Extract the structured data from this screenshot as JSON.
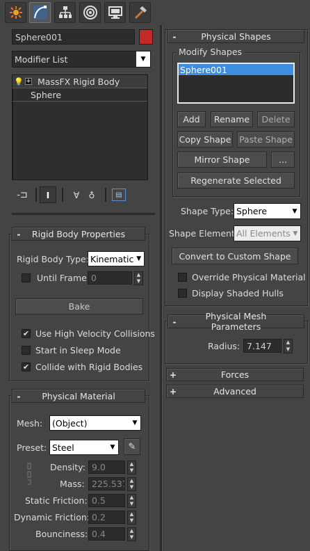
{
  "tabs": [
    {
      "name": "create-tab",
      "icon": "sun-icon"
    },
    {
      "name": "modify-tab",
      "icon": "curve-icon",
      "active": true
    },
    {
      "name": "hierarchy-tab",
      "icon": "hierarchy-icon"
    },
    {
      "name": "motion-tab",
      "icon": "motion-icon"
    },
    {
      "name": "display-tab",
      "icon": "monitor-icon"
    },
    {
      "name": "utilities-tab",
      "icon": "hammer-icon"
    }
  ],
  "object": {
    "name": "Sphere001",
    "color": "#c62828"
  },
  "modifier_list": {
    "label": "Modifier List"
  },
  "stack": {
    "items": [
      {
        "label": "MassFX Rigid Body"
      },
      {
        "label": "Sphere"
      }
    ]
  },
  "rigid_body": {
    "title": "Rigid Body Properties",
    "type_label": "Rigid Body Type:",
    "type_value": "Kinematic",
    "until_frame_label": "Until Frame:",
    "until_frame_value": "0",
    "bake_label": "Bake",
    "high_velocity_label": "Use High Velocity Collisions",
    "high_velocity_checked": true,
    "sleep_label": "Start in Sleep Mode",
    "sleep_checked": false,
    "collide_label": "Collide with Rigid Bodies",
    "collide_checked": true
  },
  "material": {
    "title": "Physical Material",
    "mesh_label": "Mesh:",
    "mesh_value": "(Object)",
    "preset_label": "Preset:",
    "preset_value": "Steel",
    "density_label": "Density:",
    "density_value": "9.0",
    "mass_label": "Mass:",
    "mass_value": "225.537",
    "static_friction_label": "Static Friction:",
    "static_friction_value": "0.5",
    "dynamic_friction_label": "Dynamic Friction:",
    "dynamic_friction_value": "0.2",
    "bounciness_label": "Bounciness:",
    "bounciness_value": "0.4"
  },
  "shapes": {
    "title": "Physical Shapes",
    "group_label": "Modify Shapes",
    "list_items": [
      "Sphere001"
    ],
    "add_label": "Add",
    "rename_label": "Rename",
    "delete_label": "Delete",
    "copy_label": "Copy Shape",
    "paste_label": "Paste Shape",
    "mirror_label": "Mirror Shape",
    "mirror_more_label": "...",
    "regenerate_label": "Regenerate Selected",
    "shape_type_label": "Shape Type:",
    "shape_type_value": "Sphere",
    "shape_element_label": "Shape Element:",
    "shape_element_value": "All Elements",
    "convert_label": "Convert to Custom Shape",
    "override_label": "Override Physical Material",
    "override_checked": false,
    "shaded_label": "Display Shaded Hulls",
    "shaded_checked": false
  },
  "mesh_params": {
    "title": "Physical Mesh Parameters",
    "radius_label": "Radius:",
    "radius_value": "7.147"
  },
  "collapsed": [
    {
      "sign": "+",
      "label": "Forces"
    },
    {
      "sign": "+",
      "label": "Advanced"
    }
  ],
  "colors": {
    "panel": "#444444",
    "field": "#2c2c2c",
    "selection": "#3d8ee0",
    "object_color": "#c62828"
  }
}
